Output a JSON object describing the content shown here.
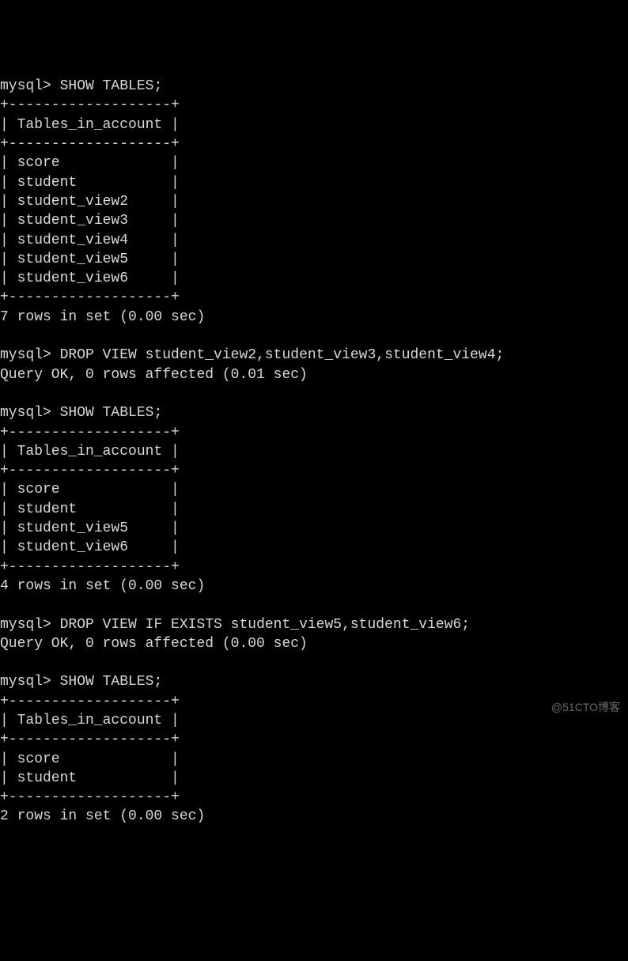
{
  "prompt": "mysql>",
  "commands": {
    "show_tables": "SHOW TABLES;",
    "drop1": "DROP VIEW student_view2,student_view3,student_view4;",
    "drop2": "DROP VIEW IF EXISTS student_view5,student_view6;"
  },
  "table_border": "+-------------------+",
  "table_header": "| Tables_in_account |",
  "table1": {
    "rows": [
      "| score             |",
      "| student           |",
      "| student_view2     |",
      "| student_view3     |",
      "| student_view4     |",
      "| student_view5     |",
      "| student_view6     |"
    ],
    "footer": "7 rows in set (0.00 sec)"
  },
  "drop1_result": "Query OK, 0 rows affected (0.01 sec)",
  "table2": {
    "rows": [
      "| score             |",
      "| student           |",
      "| student_view5     |",
      "| student_view6     |"
    ],
    "footer": "4 rows in set (0.00 sec)"
  },
  "drop2_result": "Query OK, 0 rows affected (0.00 sec)",
  "table3": {
    "rows": [
      "| score             |",
      "| student           |"
    ],
    "footer": "2 rows in set (0.00 sec)"
  },
  "watermark": "@51CTO博客"
}
